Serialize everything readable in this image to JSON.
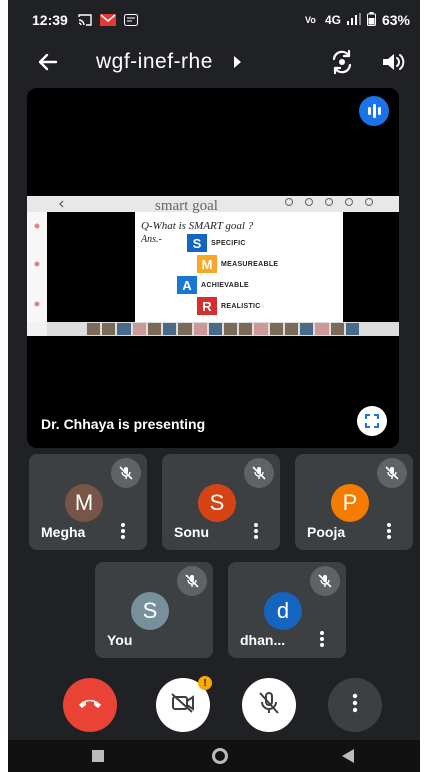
{
  "status_bar": {
    "time": "12:39",
    "network": "4G",
    "battery": "63%"
  },
  "header": {
    "meeting_code": "wgf-inef-rhe"
  },
  "presentation": {
    "presenter_label": "Dr. Chhaya is presenting",
    "slide": {
      "title": "smart goal",
      "question": "Q-What is SMART goal ?",
      "answer_prefix": "Ans.-",
      "items": [
        {
          "letter": "S",
          "word": "SPECIFIC",
          "color": "#1565c0"
        },
        {
          "letter": "M",
          "word": "MEASUREABLE",
          "color": "#f9a825"
        },
        {
          "letter": "A",
          "word": "ACHIEVABLE",
          "color": "#1976d2"
        },
        {
          "letter": "R",
          "word": "REALISTIC",
          "color": "#d32f2f"
        }
      ]
    }
  },
  "participants": [
    {
      "initial": "M",
      "name": "Megha",
      "avatar_color": "#795548"
    },
    {
      "initial": "S",
      "name": "Sonu",
      "avatar_color": "#d84315"
    },
    {
      "initial": "P",
      "name": "Pooja",
      "avatar_color": "#f57c00"
    },
    {
      "initial": "S",
      "name": "You",
      "avatar_color": "#78909c"
    },
    {
      "initial": "d",
      "name": "dhan...",
      "avatar_color": "#1565c0"
    }
  ],
  "controls": {
    "video_badge": "!",
    "end_call_color": "#ea4335"
  },
  "icons": [
    "back-arrow-icon",
    "camera-switch-icon",
    "speaker-icon",
    "audio-level-icon",
    "fullscreen-icon",
    "mic-off-icon",
    "more-vert-icon",
    "end-call-icon",
    "video-off-icon"
  ]
}
